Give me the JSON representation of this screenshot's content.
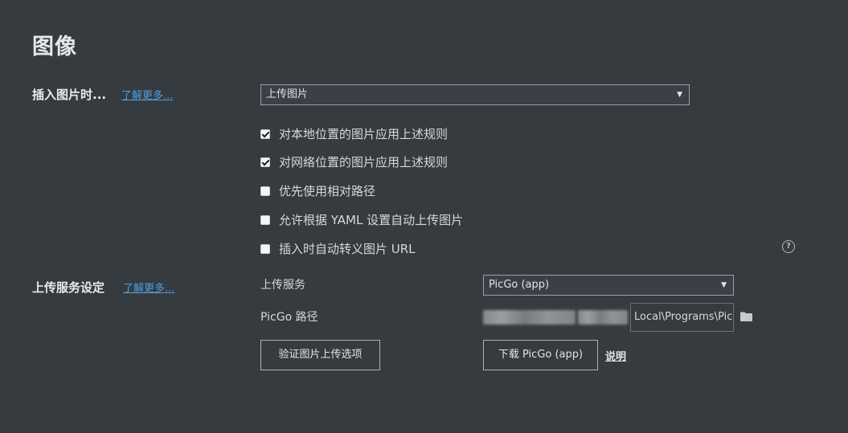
{
  "page": {
    "title": "图像"
  },
  "insert_image": {
    "label": "插入图片时...",
    "learn_more": "了解更多...",
    "select_value": "上传图片",
    "options": [
      {
        "label": "对本地位置的图片应用上述规则",
        "checked": true
      },
      {
        "label": "对网络位置的图片应用上述规则",
        "checked": true
      },
      {
        "label": "优先使用相对路径",
        "checked": false
      },
      {
        "label": "允许根据 YAML 设置自动上传图片",
        "checked": false
      },
      {
        "label": "插入时自动转义图片 URL",
        "checked": false
      }
    ],
    "help_icon": "?"
  },
  "upload_service": {
    "label": "上传服务设定",
    "learn_more": "了解更多...",
    "service_label": "上传服务",
    "service_value": "PicGo (app)",
    "path_label": "PicGo 路径",
    "path_value": "Local\\Programs\\Pic",
    "verify_button": "验证图片上传选项",
    "download_button": "下载 PicGo (app)",
    "doc_link": "说明"
  }
}
